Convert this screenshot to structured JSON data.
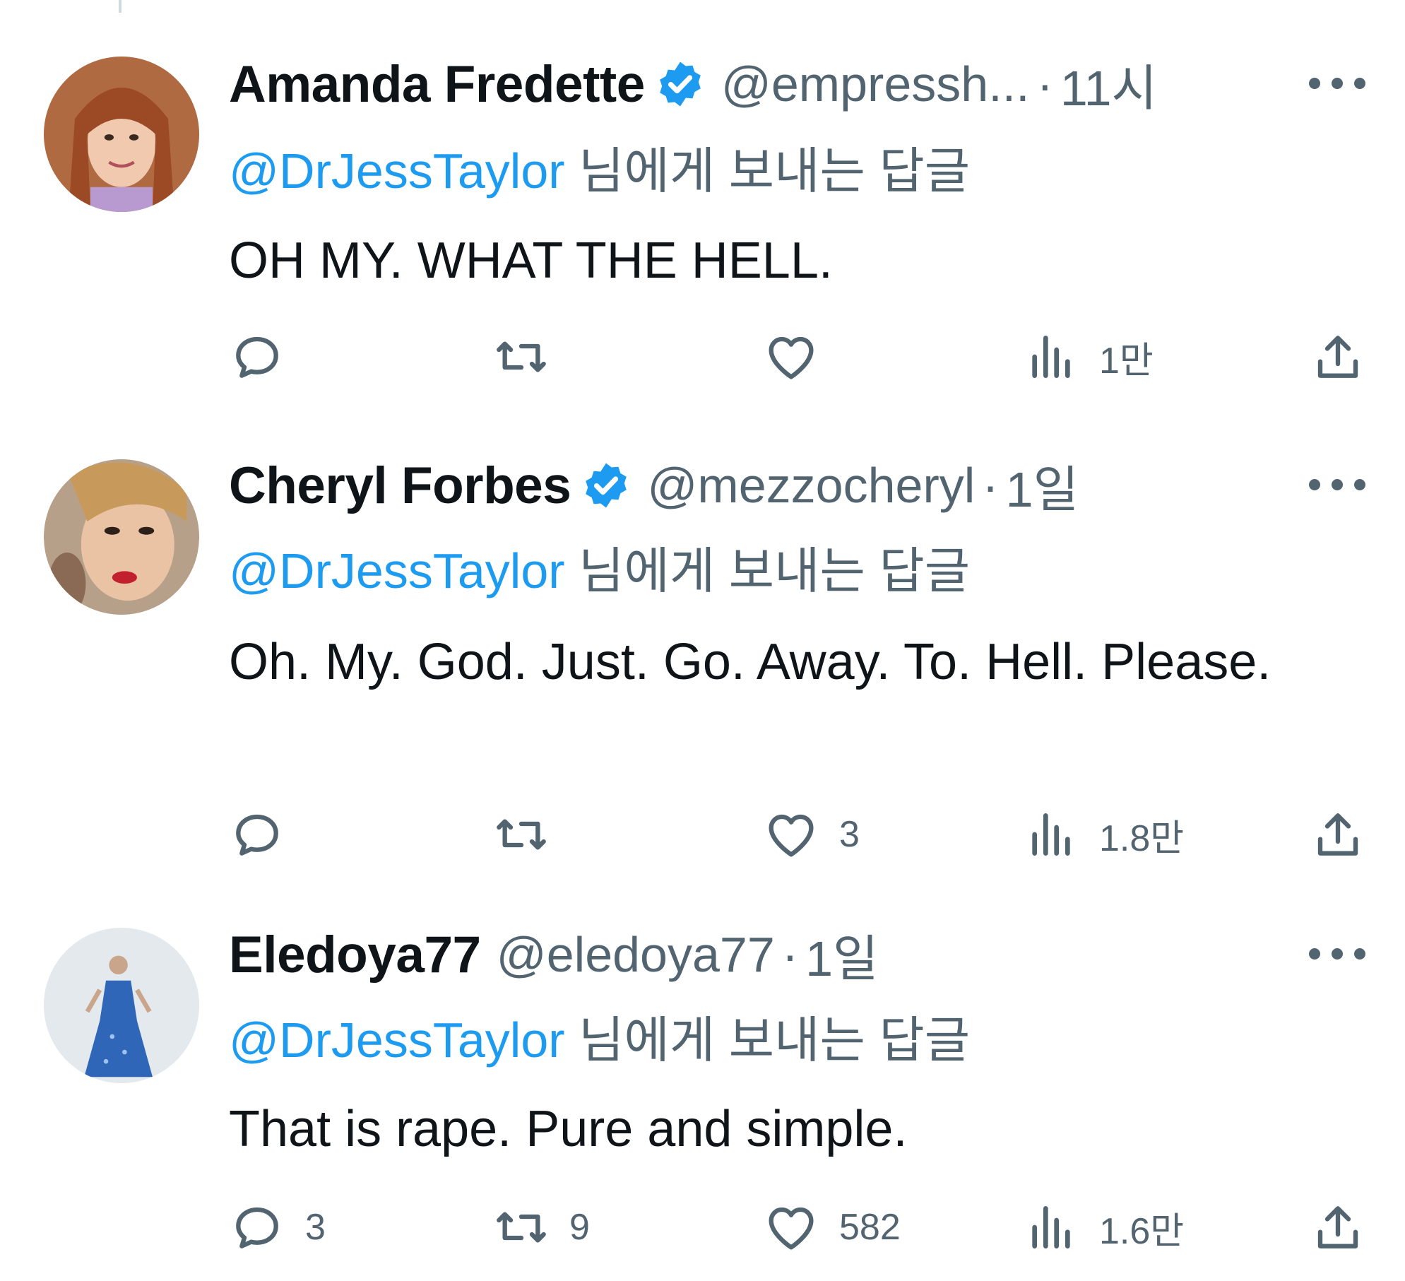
{
  "tweets": [
    {
      "name": "Amanda Fredette",
      "verified": true,
      "handle": "@empressh...",
      "separator": "·",
      "time": "11시",
      "reply_mention": "@DrJessTaylor",
      "reply_suffix": " 님에게 보내는 답글",
      "text": "OH MY. WHAT THE HELL.",
      "counts": {
        "reply": "",
        "retweet": "",
        "like": "",
        "views": "1만"
      }
    },
    {
      "name": "Cheryl Forbes",
      "verified": true,
      "handle": "@mezzocheryl",
      "separator": "·",
      "time": "1일",
      "reply_mention": "@DrJessTaylor",
      "reply_suffix": " 님에게 보내는 답글",
      "text": "Oh. My. God. Just. Go. Away. To. Hell. Please.",
      "counts": {
        "reply": "",
        "retweet": "",
        "like": "3",
        "views": "1.8만"
      }
    },
    {
      "name": "Eledoya77",
      "verified": false,
      "handle": "@eledoya77",
      "separator": "·",
      "time": "1일",
      "reply_mention": "@DrJessTaylor",
      "reply_suffix": " 님에게 보내는 답글",
      "text": "That is rape. Pure and simple.",
      "counts": {
        "reply": "3",
        "retweet": "9",
        "like": "582",
        "views": "1.6만"
      }
    }
  ],
  "colors": {
    "accent": "#1d9bf0",
    "secondary_text": "#536471",
    "primary_text": "#0f1419"
  },
  "icons": {
    "reply": "speech-bubble-icon",
    "retweet": "retweet-arrows-icon",
    "like": "heart-icon",
    "views": "bar-chart-icon",
    "share": "share-upload-icon",
    "verified": "verified-badge-icon",
    "more": "more-dots-icon"
  }
}
